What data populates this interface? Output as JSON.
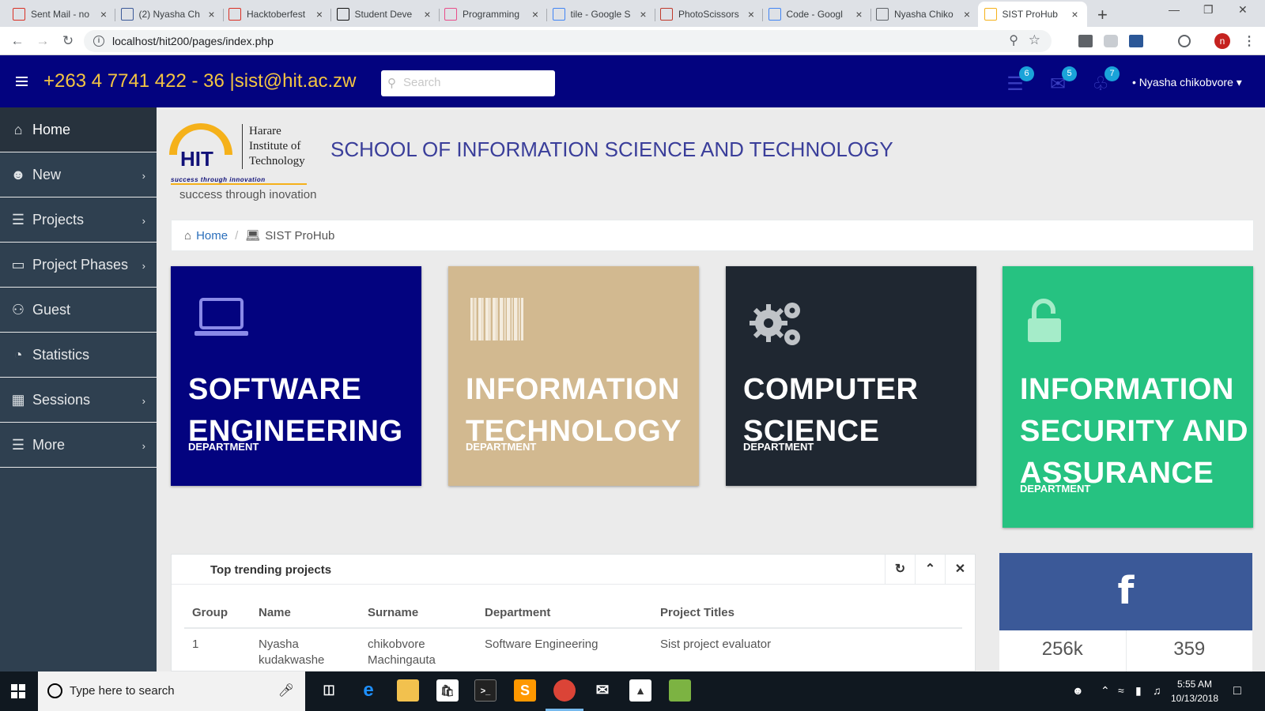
{
  "browser": {
    "tabs": [
      {
        "label": "Sent Mail - no",
        "icon": "gmail-icon",
        "color": "#d93025"
      },
      {
        "label": "(2) Nyasha Ch",
        "icon": "facebook-icon",
        "color": "#3b5998"
      },
      {
        "label": "Hacktoberfest",
        "icon": "gmail-icon",
        "color": "#d93025"
      },
      {
        "label": "Student Deve",
        "icon": "github-icon",
        "color": "#111111"
      },
      {
        "label": "Programming",
        "icon": "pinwheel-icon",
        "color": "#e94d8a"
      },
      {
        "label": "tile - Google S",
        "icon": "google-icon",
        "color": "#4285f4"
      },
      {
        "label": "PhotoScissors",
        "icon": "photoscissors-icon",
        "color": "#c0392b"
      },
      {
        "label": "Code - Googl",
        "icon": "google-icon",
        "color": "#4285f4"
      },
      {
        "label": "Nyasha Chiko",
        "icon": "document-icon",
        "color": "#5f6368"
      },
      {
        "label": "SIST ProHub",
        "icon": "hit-logo-icon",
        "color": "#f5b11a",
        "active": true
      }
    ],
    "url": "localhost/hit200/pages/index.php"
  },
  "header": {
    "contact": "+263 4 7741 422 - 36 |sist@hit.ac.zw",
    "search_placeholder": "Search",
    "tasks_count": "6",
    "messages_count": "5",
    "notifications_count": "7",
    "user_name": "• Nyasha chikobvore ▾"
  },
  "sidebar": {
    "items": [
      {
        "label": "Home",
        "icon": "home-icon",
        "has_submenu": false
      },
      {
        "label": "New",
        "icon": "user-icon",
        "has_submenu": true
      },
      {
        "label": "Projects",
        "icon": "list-icon",
        "has_submenu": true
      },
      {
        "label": "Project Phases",
        "icon": "desktop-icon",
        "has_submenu": true
      },
      {
        "label": "Guest",
        "icon": "users-icon",
        "has_submenu": false
      },
      {
        "label": "Statistics",
        "icon": "pie-chart-icon",
        "has_submenu": false
      },
      {
        "label": "Sessions",
        "icon": "table-icon",
        "has_submenu": true
      },
      {
        "label": "More",
        "icon": "list-icon",
        "has_submenu": true
      }
    ]
  },
  "logo": {
    "hit": "HIT",
    "name_line1": "Harare",
    "name_line2": "Institute of",
    "name_line3": "Technology",
    "tagline": "success through innovation",
    "motto": "success through inovation"
  },
  "school_title": "SCHOOL OF INFORMATION SCIENCE AND TECHNOLOGY",
  "breadcrumb": {
    "home": "Home",
    "current": "SIST ProHub"
  },
  "departments": [
    {
      "name_lines": [
        "SOFTWARE",
        "ENGINEERING"
      ],
      "sub": "DEPARTMENT",
      "icon": "laptop-icon",
      "color": "#03037f"
    },
    {
      "name_lines": [
        "INFORMATION",
        "TECHNOLOGY"
      ],
      "sub": "DEPARTMENT",
      "icon": "barcode-icon",
      "color": "#d2b990"
    },
    {
      "name_lines": [
        "COMPUTER",
        "SCIENCE"
      ],
      "sub": "DEPARTMENT",
      "icon": "gears-icon",
      "color": "#1f2731"
    },
    {
      "name_lines": [
        "INFORMATION",
        "SECURITY AND",
        "ASSURANCE"
      ],
      "sub": "DEPARTMENT",
      "icon": "unlock-icon",
      "color": "#26c281"
    }
  ],
  "trending": {
    "title": "Top trending projects",
    "columns": [
      "Group",
      "Name",
      "Surname",
      "Department",
      "Project Titles"
    ],
    "rows": [
      [
        "1",
        "Nyasha kudakwashe",
        "chikobvore Machingauta",
        "Software Engineering",
        "Sist project evaluator"
      ]
    ]
  },
  "facebook": {
    "glyph": "f",
    "stat1": "256k",
    "stat2": "359"
  },
  "taskbar": {
    "search_placeholder": "Type here to search",
    "time": "5:55 AM",
    "date": "10/13/2018"
  }
}
